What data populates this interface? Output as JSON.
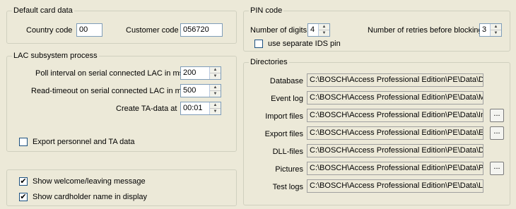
{
  "default_card": {
    "title": "Default card data",
    "country_code_label": "Country code",
    "country_code_value": "00",
    "customer_code_label": "Customer code",
    "customer_code_value": "056720"
  },
  "lac": {
    "title": "LAC subsystem process",
    "poll_label": "Poll interval on serial connected LAC in ms",
    "poll_value": "200",
    "read_label": "Read-timeout on serial connected LAC in ms",
    "read_value": "500",
    "ta_label": "Create TA-data at",
    "ta_value": "00:01",
    "export_label": "Export personnel and TA data",
    "export_checked": false
  },
  "display": {
    "welcome_label": "Show welcome/leaving message",
    "welcome_checked": true,
    "name_label": "Show cardholder name in display",
    "name_checked": true
  },
  "pin": {
    "title": "PIN code",
    "digits_label": "Number of digits",
    "digits_value": "4",
    "retries_label": "Number of retries before blocking",
    "retries_value": "3",
    "ids_label": "use separate IDS pin",
    "ids_checked": false
  },
  "directories": {
    "title": "Directories",
    "browse_label": "...",
    "rows": [
      {
        "label": "Database",
        "value": "C:\\BOSCH\\Access Professional Edition\\PE\\Data\\Db",
        "browse": false
      },
      {
        "label": "Event log",
        "value": "C:\\BOSCH\\Access Professional Edition\\PE\\Data\\Ms",
        "browse": false
      },
      {
        "label": "Import files",
        "value": "C:\\BOSCH\\Access Professional Edition\\PE\\Data\\Im",
        "browse": true
      },
      {
        "label": "Export files",
        "value": "C:\\BOSCH\\Access Professional Edition\\PE\\Data\\Ex",
        "browse": true
      },
      {
        "label": "DLL-files",
        "value": "C:\\BOSCH\\Access Professional Edition\\PE\\Data\\Dll",
        "browse": false
      },
      {
        "label": "Pictures",
        "value": "C:\\BOSCH\\Access Professional Edition\\PE\\Data\\Pic",
        "browse": true
      },
      {
        "label": "Test logs",
        "value": "C:\\BOSCH\\Access Professional Edition\\PE\\Data\\Lo",
        "browse": false
      }
    ]
  },
  "icons": {
    "spin_up": "spin-up-arrow",
    "spin_down": "spin-down-arrow",
    "check": "check-mark"
  }
}
